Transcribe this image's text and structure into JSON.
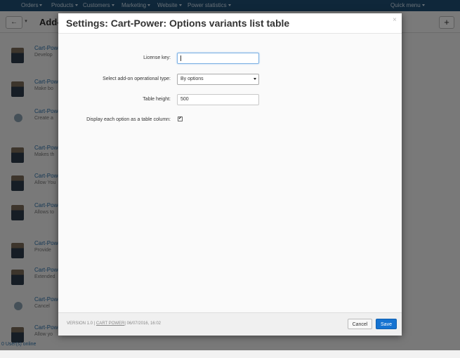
{
  "topnav": {
    "items": [
      "Orders",
      "Products",
      "Customers",
      "Marketing",
      "Website",
      "Power statistics"
    ],
    "quick_menu": "Quick menu"
  },
  "toolbar": {
    "back_icon": "←",
    "title": "Add-"
  },
  "background_list": [
    {
      "name": "Cart-Power",
      "desc": "Develop"
    },
    {
      "name": "Cart-Power",
      "desc": "Make bo"
    },
    {
      "name": "Cart-Power",
      "desc": "Create a"
    },
    {
      "name": "Cart-Power",
      "desc": "Makes th"
    },
    {
      "name": "Cart-Power",
      "desc": "Allow You"
    },
    {
      "name": "Cart-Power",
      "desc": "Allows to"
    },
    {
      "name": "Cart-Power",
      "desc": "Provide"
    },
    {
      "name": "Cart-Power",
      "desc": "Extended"
    },
    {
      "name": "Cart-Power",
      "desc": "Cancel"
    },
    {
      "name": "Cart-Power",
      "desc": "Allow yo"
    }
  ],
  "footer_status": "0 User(s) online",
  "modal": {
    "title": "Settings: Cart-Power: Options variants list table",
    "close_icon": "×",
    "fields": {
      "license_key_label": "License key:",
      "license_key_value": "",
      "operational_type_label": "Select add-on operational type:",
      "operational_type_value": "By options",
      "table_height_label": "Table height:",
      "table_height_value": "500",
      "display_column_label": "Display each option as a table column:",
      "display_column_checked": true
    },
    "footer": {
      "version": "VERSION 1.0",
      "separator": "|",
      "vendor": "CART POWER",
      "date": "06/07/2016, 16:02"
    },
    "buttons": {
      "cancel": "Cancel",
      "save": "Save"
    }
  },
  "colors": {
    "accent": "#1673d1",
    "nav_bg": "#1f4f75"
  }
}
